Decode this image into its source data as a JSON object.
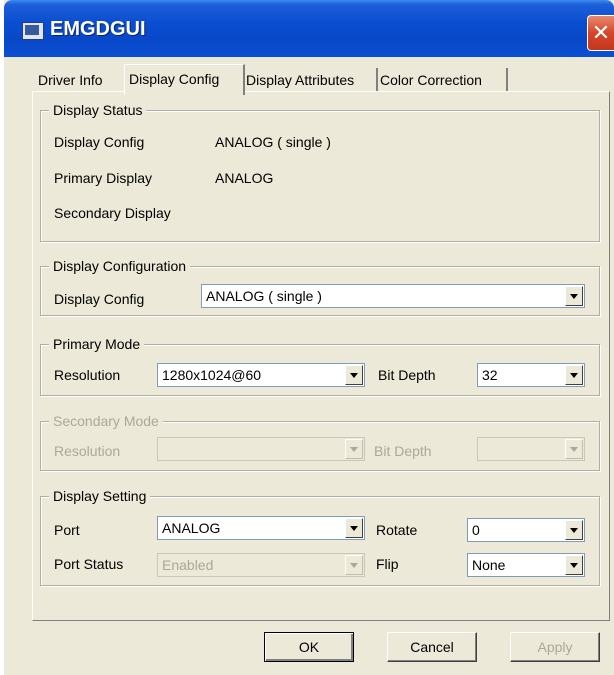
{
  "window": {
    "title": "EMGDGUI"
  },
  "tabs": [
    {
      "label": "Driver Info"
    },
    {
      "label": "Display Config"
    },
    {
      "label": "Display Attributes"
    },
    {
      "label": "Color Correction"
    }
  ],
  "display_status": {
    "title": "Display Status",
    "config_label": "Display Config",
    "config_value": "ANALOG ( single )",
    "primary_label": "Primary Display",
    "primary_value": "ANALOG",
    "secondary_label": "Secondary Display",
    "secondary_value": ""
  },
  "display_configuration": {
    "title": "Display Configuration",
    "config_label": "Display Config",
    "config_value": "ANALOG ( single )"
  },
  "primary_mode": {
    "title": "Primary Mode",
    "resolution_label": "Resolution",
    "resolution_value": "1280x1024@60",
    "bitdepth_label": "Bit Depth",
    "bitdepth_value": "32"
  },
  "secondary_mode": {
    "title": "Secondary Mode",
    "resolution_label": "Resolution",
    "resolution_value": "",
    "bitdepth_label": "Bit Depth",
    "bitdepth_value": ""
  },
  "display_setting": {
    "title": "Display Setting",
    "port_label": "Port",
    "port_value": "ANALOG",
    "rotate_label": "Rotate",
    "rotate_value": "0",
    "port_status_label": "Port Status",
    "port_status_value": "Enabled",
    "flip_label": "Flip",
    "flip_value": "None"
  },
  "buttons": {
    "ok": "OK",
    "cancel": "Cancel",
    "apply": "Apply"
  }
}
